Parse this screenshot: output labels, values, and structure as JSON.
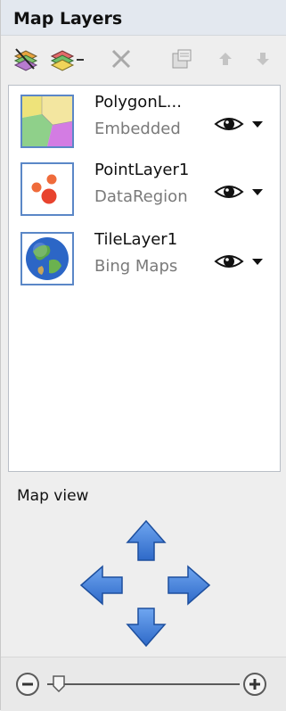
{
  "header": {
    "title": "Map Layers"
  },
  "toolbar": {
    "buttons": [
      {
        "icon": "add-layer-wizard-icon"
      },
      {
        "icon": "add-layer-dropdown-icon"
      },
      {
        "icon": "delete-x-icon"
      },
      {
        "icon": "layer-properties-icon"
      },
      {
        "icon": "move-up-icon"
      },
      {
        "icon": "move-down-icon"
      }
    ]
  },
  "layers": [
    {
      "name": "PolygonL...",
      "source": "Embedded",
      "visibility_icon": "eye-icon"
    },
    {
      "name": "PointLayer1",
      "source": "DataRegion",
      "visibility_icon": "eye-icon"
    },
    {
      "name": "TileLayer1",
      "source": "Bing Maps",
      "visibility_icon": "eye-icon"
    }
  ],
  "map_view": {
    "label": "Map view",
    "pan_arrows": [
      "up",
      "left",
      "right",
      "down"
    ]
  },
  "zoom": {
    "minus_icon": "zoom-out-icon",
    "plus_icon": "zoom-in-icon",
    "level": 0.04
  },
  "colors": {
    "arrow": "#3f7ed8",
    "title_bg": "#e3e8ef",
    "list_border": "#b9bec6"
  }
}
